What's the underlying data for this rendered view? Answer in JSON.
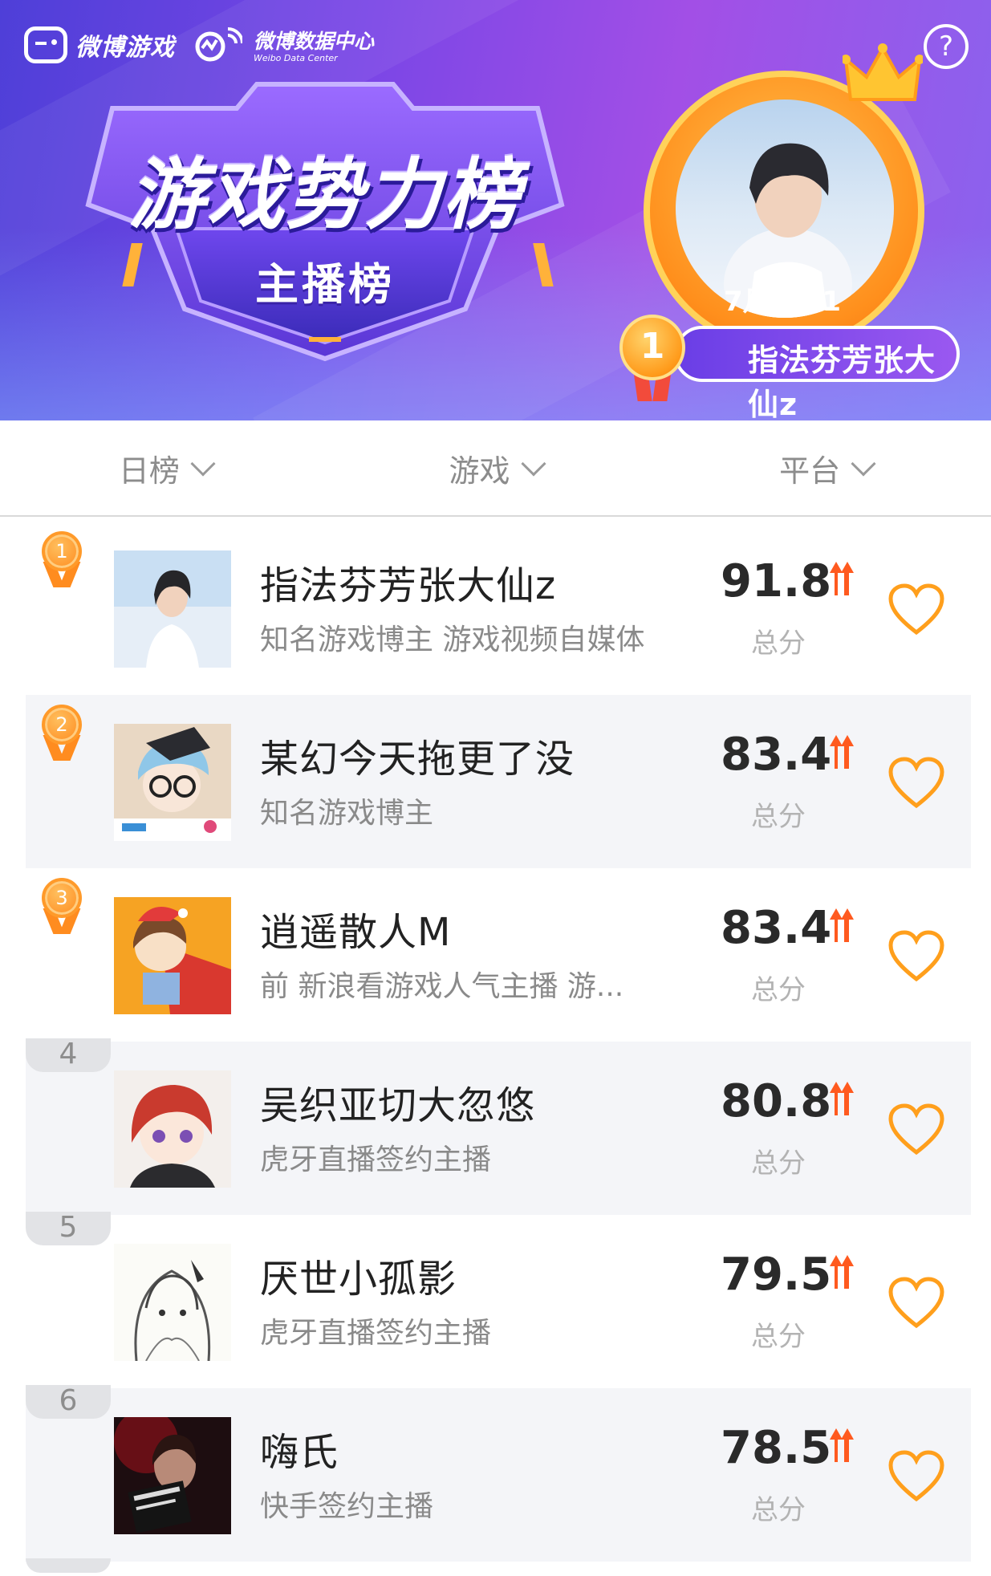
{
  "banner": {
    "brand_game": "微博游戏",
    "brand_data": "微博数据中心",
    "brand_data_en": "Weibo Data Center",
    "help_icon": "?",
    "title": "游戏势力榜",
    "subtitle": "主播榜",
    "champion": {
      "month_label": "7月No.1",
      "rank": "1",
      "name": "指法芬芳张大仙z"
    }
  },
  "filters": [
    {
      "label": "日榜"
    },
    {
      "label": "游戏"
    },
    {
      "label": "平台"
    }
  ],
  "score_label": "总分",
  "rows": [
    {
      "rank": "1",
      "name": "指法芬芳张大仙z",
      "desc": "知名游戏博主 游戏视频自媒体",
      "score": "91.8"
    },
    {
      "rank": "2",
      "name": "某幻今天拖更了没",
      "desc": "知名游戏博主",
      "score": "83.4"
    },
    {
      "rank": "3",
      "name": "逍遥散人M",
      "desc": "前 新浪看游戏人气主播 游...",
      "score": "83.4"
    },
    {
      "rank": "4",
      "name": "吴织亚切大忽悠",
      "desc": "虎牙直播签约主播",
      "score": "80.8"
    },
    {
      "rank": "5",
      "name": "厌世小孤影",
      "desc": "虎牙直播签约主播",
      "score": "79.5"
    },
    {
      "rank": "6",
      "name": "嗨氏",
      "desc": "快手签约主播",
      "score": "78.5"
    }
  ],
  "colors": {
    "accent_orange": "#ff7a1a",
    "banner_purple": "#7a46e6",
    "up_arrow": "#ff5a1f"
  }
}
